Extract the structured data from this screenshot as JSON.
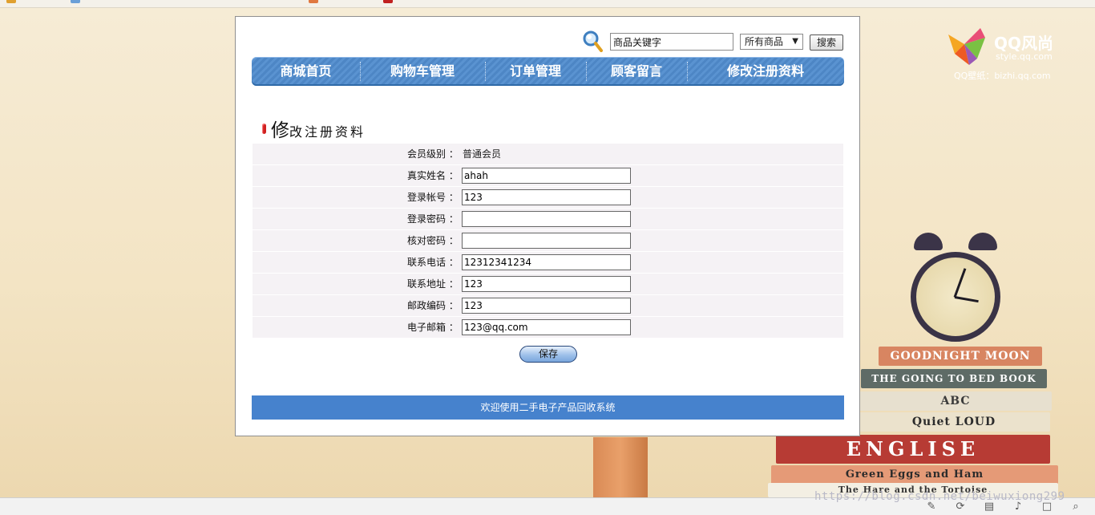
{
  "search": {
    "keyword_value": "商品关键字",
    "category_selected": "所有商品",
    "button_label": "搜索"
  },
  "nav": {
    "items": [
      "商城首页",
      "购物车管理",
      "订单管理",
      "顾客留言",
      "修改注册资料"
    ]
  },
  "page": {
    "title_first": "修",
    "title_rest": "改注册资料"
  },
  "form": {
    "member_level": {
      "label": "会员级别 ：",
      "value": "普通会员"
    },
    "fields": [
      {
        "label": "真实姓名 ：",
        "value": "ahah"
      },
      {
        "label": "登录帐号 ：",
        "value": "123"
      },
      {
        "label": "登录密码 ：",
        "value": ""
      },
      {
        "label": "核对密码 ：",
        "value": ""
      },
      {
        "label": "联系电话 ：",
        "value": "12312341234"
      },
      {
        "label": "联系地址 ：",
        "value": "123"
      },
      {
        "label": "邮政编码 ：",
        "value": "123"
      },
      {
        "label": "电子邮箱 ：",
        "value": "123@qq.com"
      }
    ],
    "save_label": "保存"
  },
  "footer": {
    "text": "欢迎使用二手电子产品回收系统"
  },
  "background": {
    "brand": "QQ风尚",
    "brand_url": "style.qq.com",
    "wallpaper_credit": "QQ壁纸：bizhi.qq.com",
    "books": [
      "GOODNIGHT MOON",
      "THE GOING TO BED BOOK",
      "ABC",
      "Quiet LOUD",
      "ENGLISE",
      "Green Eggs and Ham",
      "The Hare and the Tortoise"
    ]
  },
  "watermark": "https://blog.csdn.net/beiwuxiong299",
  "colors": {
    "nav_blue": "#4d86c5",
    "footer_blue": "#4682cd",
    "title_mark_red": "#d02020",
    "row_bg": "#f5f2f5"
  },
  "icons": [
    "search-magnifier-icon",
    "dropdown-arrow-icon",
    "title-bullet-icon"
  ]
}
